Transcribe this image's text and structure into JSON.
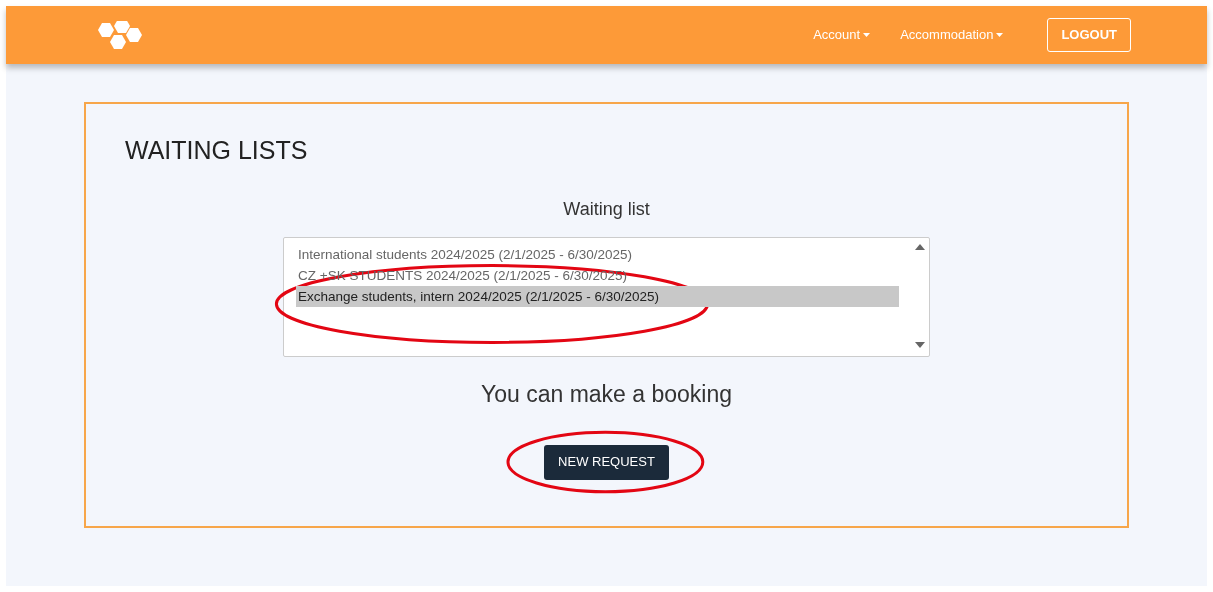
{
  "navbar": {
    "menus": [
      {
        "label": "Account"
      },
      {
        "label": "Accommodation"
      }
    ],
    "logout": "LOGOUT"
  },
  "page": {
    "title": "WAITING LISTS"
  },
  "waiting_list": {
    "label": "Waiting list",
    "circled": true,
    "options": [
      {
        "label": "International students 2024/2025 (2/1/2025 - 6/30/2025)",
        "selected": false
      },
      {
        "label": "CZ +SK STUDENTS 2024/2025 (2/1/2025 - 6/30/2025)",
        "selected": false
      },
      {
        "label": "Exchange students, intern 2024/2025 (2/1/2025 - 6/30/2025)",
        "selected": true
      }
    ]
  },
  "booking": {
    "message": "You can make a booking",
    "button": "NEW REQUEST",
    "circled": true
  }
}
